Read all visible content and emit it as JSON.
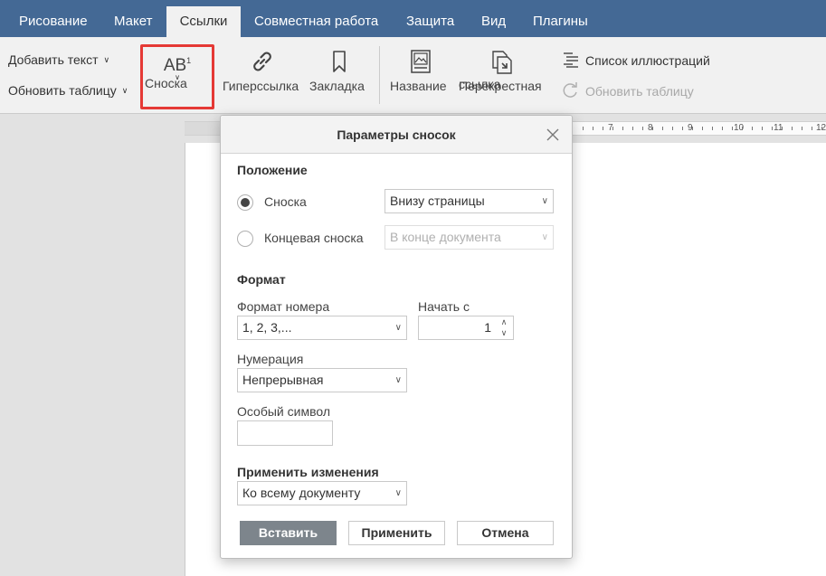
{
  "tabs": [
    "Рисование",
    "Макет",
    "Ссылки",
    "Совместная работа",
    "Защита",
    "Вид",
    "Плагины"
  ],
  "active_tab": "Ссылки",
  "toolbar": {
    "add_text": "Добавить текст",
    "update_table": "Обновить таблицу",
    "footnote_icon_text": "AB",
    "footnote_icon_sup": "1",
    "footnote": "Сноска",
    "hyperlink": "Гиперссылка",
    "bookmark": "Закладка",
    "caption": "Название",
    "cross_ref_line1": "Перекрестная",
    "cross_ref_line2": "ссылка",
    "illustrations_list": "Список иллюстраций",
    "update_table_disabled": "Обновить таблицу"
  },
  "ruler": {
    "numbers": [
      "7",
      "8",
      "9",
      "10",
      "11",
      "12"
    ]
  },
  "dialog": {
    "title": "Параметры сносок",
    "position_section": "Положение",
    "footnote_option": "Сноска",
    "footnote_location": "Внизу страницы",
    "endnote_option": "Концевая сноска",
    "endnote_location": "В конце документа",
    "format_section": "Формат",
    "number_format_label": "Формат номера",
    "number_format_value": "1, 2, 3,...",
    "start_at_label": "Начать с",
    "start_at_value": "1",
    "numbering_label": "Нумерация",
    "numbering_value": "Непрерывная",
    "custom_mark_label": "Особый символ",
    "custom_mark_value": "",
    "apply_changes_section": "Применить изменения",
    "apply_to_value": "Ко всему документу",
    "insert_button": "Вставить",
    "apply_button": "Применить",
    "cancel_button": "Отмена"
  },
  "colors": {
    "tabbar": "#446995",
    "highlight": "#e53935",
    "primary_button": "#7d858c"
  }
}
